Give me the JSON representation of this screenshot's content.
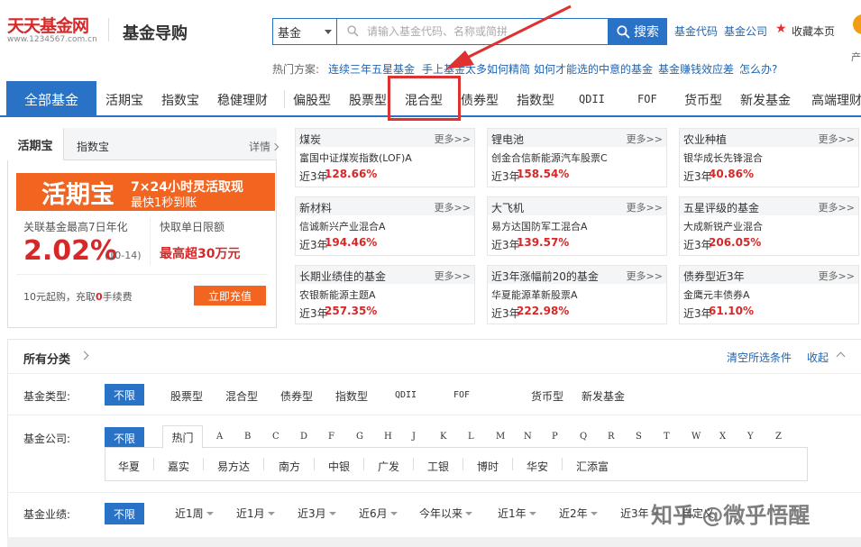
{
  "header": {
    "logo_main": "天天基金网",
    "logo_sub": "www.1234567.com.cn",
    "site_title": "基金导购",
    "search": {
      "type_value": "基金",
      "placeholder": "请输入基金代码、名称或简拼",
      "button_label": "搜索"
    },
    "top_links": [
      "基金代码",
      "基金公司"
    ],
    "favorite_label": "收藏本页",
    "cut_text": "产"
  },
  "hot": {
    "label": "热门方案:",
    "links": [
      "连续三年五星基金",
      "手上基金太多如何精简",
      "如何才能选的中意的基金",
      "基金赚钱效应差",
      "怎么办?"
    ]
  },
  "nav": {
    "all_label": "全部基金",
    "items": [
      "活期宝",
      "指数宝",
      "稳健理财",
      "偏股型",
      "股票型",
      "混合型",
      "债券型",
      "指数型",
      "QDII",
      "FOF",
      "货币型",
      "新发基金",
      "高端理财"
    ]
  },
  "card": {
    "tab_active": "活期宝",
    "tab_other": "指数宝",
    "more": "详情",
    "banner_big": "活期宝",
    "banner_line1": "7×24小时灵活取现",
    "banner_line2": "最快1秒到账",
    "stat1_label": "关联基金最高7日年化",
    "stat2_label": "快取单日限额",
    "rate": "2.02%",
    "rate_date": "(10-14)",
    "limit": "最高超30万元",
    "fee_prefix": "10元起购，充取",
    "fee_zero": "0",
    "fee_suffix": "手续费",
    "recharge": "立即充值"
  },
  "cells": [
    {
      "cat": "煤炭",
      "more": "更多>>",
      "name": "富国中证煤炭指数(LOF)A",
      "perf_label": "近3年",
      "perf": "128.66%"
    },
    {
      "cat": "锂电池",
      "more": "更多>>",
      "name": "创金合信新能源汽车股票C",
      "perf_label": "近3年",
      "perf": "158.54%"
    },
    {
      "cat": "农业种植",
      "more": "更多>>",
      "name": "银华成长先锋混合",
      "perf_label": "近3年",
      "perf": "40.86%"
    },
    {
      "cat": "新材料",
      "more": "更多>>",
      "name": "信诚新兴产业混合A",
      "perf_label": "近3年",
      "perf": "194.46%"
    },
    {
      "cat": "大飞机",
      "more": "更多>>",
      "name": "易方达国防军工混合A",
      "perf_label": "近3年",
      "perf": "139.57%"
    },
    {
      "cat": "五星评级的基金",
      "more": "更多>>",
      "name": "大成新锐产业混合",
      "perf_label": "近3年",
      "perf": "206.05%"
    },
    {
      "cat": "长期业绩佳的基金",
      "more": "更多>>",
      "name": "农银新能源主题A",
      "perf_label": "近3年",
      "perf": "257.35%"
    },
    {
      "cat": "近3年涨幅前20的基金",
      "more": "更多>>",
      "name": "华夏能源革新股票A",
      "perf_label": "近3年",
      "perf": "222.98%"
    },
    {
      "cat": "债券型近3年",
      "more": "更多>>",
      "name": "金鹰元丰债券A",
      "perf_label": "近3年",
      "perf": "61.10%"
    }
  ],
  "filter": {
    "title": "所有分类",
    "clear": "清空所选条件",
    "collapse": "收起",
    "unlimited": "不限",
    "type_label": "基金类型:",
    "types": [
      "股票型",
      "混合型",
      "债券型",
      "指数型",
      "QDII",
      "FOF",
      "货币型",
      "新发基金"
    ],
    "company_label": "基金公司:",
    "hot_tab": "热门",
    "letters": [
      "A",
      "B",
      "C",
      "D",
      "F",
      "G",
      "H",
      "J",
      "K",
      "L",
      "M",
      "N",
      "P",
      "Q",
      "R",
      "S",
      "T",
      "W",
      "X",
      "Y",
      "Z"
    ],
    "companies": [
      "华夏",
      "嘉实",
      "易方达",
      "南方",
      "中银",
      "广发",
      "工银",
      "博时",
      "华安",
      "汇添富"
    ],
    "perf_label": "基金业绩:",
    "periods": [
      "近1周",
      "近1月",
      "近3月",
      "近6月",
      "今年以来",
      "近1年",
      "近2年",
      "近3年",
      "自定义"
    ]
  },
  "watermark": "知乎 @微乎悟醒",
  "colors": {
    "brand_blue": "#2a72c6",
    "accent_orange": "#f26521",
    "rise_red": "#d62828",
    "annotation_red": "#e03131"
  }
}
